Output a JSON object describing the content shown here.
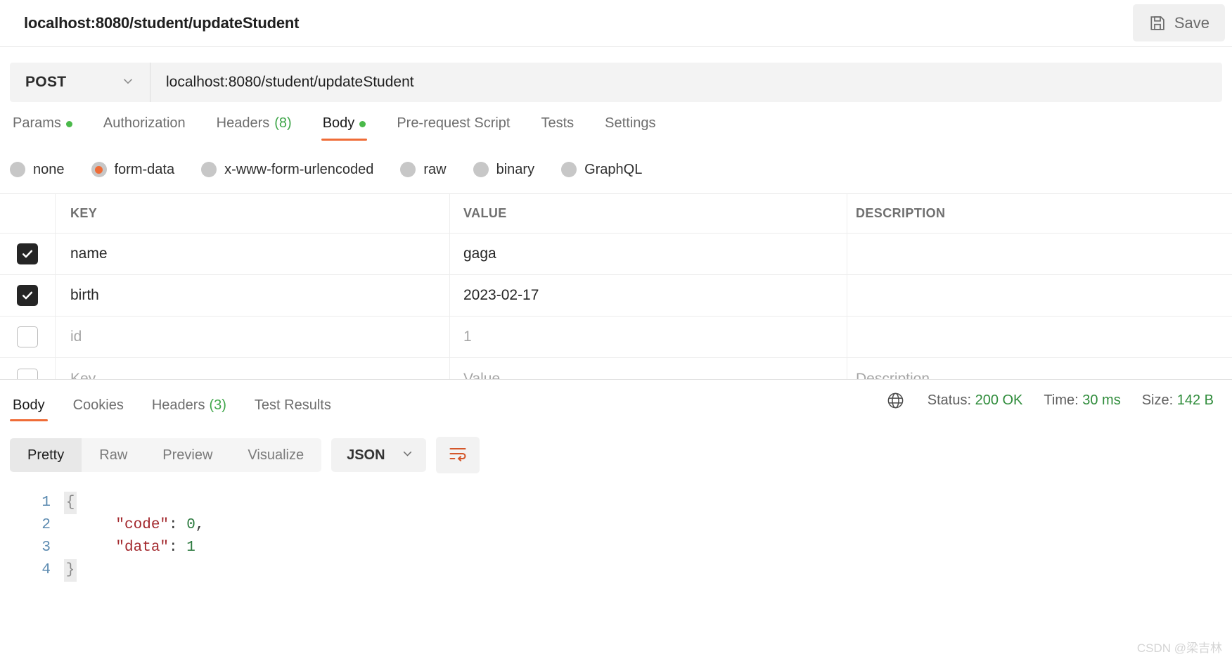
{
  "request": {
    "title": "localhost:8080/student/updateStudent",
    "save_label": "Save",
    "method": "POST",
    "url": "localhost:8080/student/updateStudent",
    "tabs": [
      {
        "label": "Params",
        "dot": true,
        "count": "",
        "active": false
      },
      {
        "label": "Authorization",
        "dot": false,
        "count": "",
        "active": false
      },
      {
        "label": "Headers",
        "dot": false,
        "count": "(8)",
        "active": false
      },
      {
        "label": "Body",
        "dot": true,
        "count": "",
        "active": true
      },
      {
        "label": "Pre-request Script",
        "dot": false,
        "count": "",
        "active": false
      },
      {
        "label": "Tests",
        "dot": false,
        "count": "",
        "active": false
      },
      {
        "label": "Settings",
        "dot": false,
        "count": "",
        "active": false
      }
    ],
    "body_modes": [
      {
        "label": "none",
        "selected": false
      },
      {
        "label": "form-data",
        "selected": true
      },
      {
        "label": "x-www-form-urlencoded",
        "selected": false
      },
      {
        "label": "raw",
        "selected": false
      },
      {
        "label": "binary",
        "selected": false
      },
      {
        "label": "GraphQL",
        "selected": false
      }
    ],
    "table": {
      "headers": {
        "key": "KEY",
        "value": "VALUE",
        "description": "DESCRIPTION"
      },
      "rows": [
        {
          "checked": true,
          "key": "name",
          "value": "gaga",
          "description": "",
          "muted": false
        },
        {
          "checked": true,
          "key": "birth",
          "value": "2023-02-17",
          "description": "",
          "muted": false
        },
        {
          "checked": false,
          "key": "id",
          "value": "1",
          "description": "",
          "muted": true
        }
      ],
      "new_row": {
        "key_placeholder": "Key",
        "value_placeholder": "Value",
        "description_placeholder": "Description"
      }
    }
  },
  "response": {
    "tabs": [
      {
        "label": "Body",
        "count": "",
        "active": true
      },
      {
        "label": "Cookies",
        "count": "",
        "active": false
      },
      {
        "label": "Headers",
        "count": "(3)",
        "active": false
      },
      {
        "label": "Test Results",
        "count": "",
        "active": false
      }
    ],
    "meta": {
      "status_label": "Status:",
      "status_value": "200 OK",
      "time_label": "Time:",
      "time_value": "30 ms",
      "size_label": "Size:",
      "size_value": "142 B"
    },
    "view_modes": [
      {
        "label": "Pretty",
        "active": true
      },
      {
        "label": "Raw",
        "active": false
      },
      {
        "label": "Preview",
        "active": false
      },
      {
        "label": "Visualize",
        "active": false
      }
    ],
    "format": "JSON",
    "body_lines": [
      {
        "n": "1",
        "fold": "{",
        "content": ""
      },
      {
        "n": "2",
        "fold": "",
        "content": "\"code\": 0,"
      },
      {
        "n": "3",
        "fold": "",
        "content": "\"data\": 1"
      },
      {
        "n": "4",
        "fold": "}",
        "content": ""
      }
    ],
    "body_json": {
      "code": 0,
      "data": 1
    }
  },
  "watermark": "CSDN @梁吉林",
  "colors": {
    "accent": "#ef6c37",
    "status_green": "#2f8c3b",
    "dot_green": "#4ab94a",
    "json_key": "#a3282d",
    "json_num": "#2c7a3f",
    "gutter": "#5b8ab0"
  }
}
